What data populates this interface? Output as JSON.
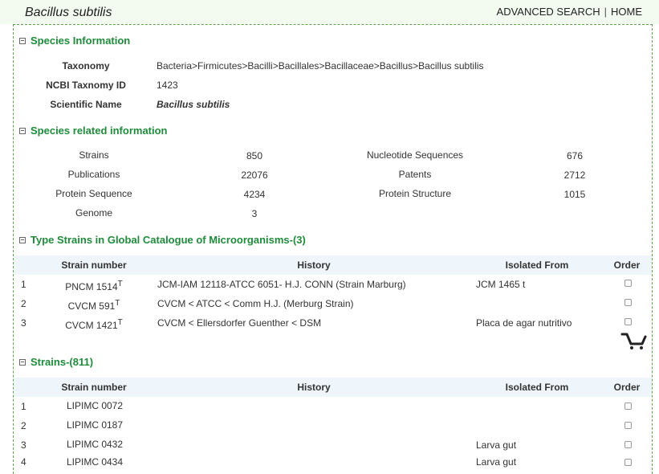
{
  "header": {
    "title": "Bacillus subtilis",
    "nav": {
      "advanced_search": "ADVANCED SEARCH",
      "separator": "|",
      "home": "HOME"
    }
  },
  "species_info": {
    "heading": "Species Information",
    "taxonomy_label": "Taxonomy",
    "taxonomy_value": "Bacteria>Firmicutes>Bacilli>Bacillales>Bacillaceae>Bacillus>Bacillus subtilis",
    "ncbi_label": "NCBI Taxnomy ID",
    "ncbi_value": "1423",
    "sci_label": "Scientific Name",
    "sci_value": "Bacillus subtilis"
  },
  "related": {
    "heading": "Species related information",
    "left": [
      {
        "label": "Strains",
        "value": "850"
      },
      {
        "label": "Publications",
        "value": "22076"
      },
      {
        "label": "Protein Sequence",
        "value": "4234"
      },
      {
        "label": "Genome",
        "value": "3"
      }
    ],
    "right": [
      {
        "label": "Nucleotide Sequences",
        "value": "676"
      },
      {
        "label": "Patents",
        "value": "2712"
      },
      {
        "label": "Protein Structure",
        "value": "1015"
      }
    ]
  },
  "type_strains": {
    "heading": "Type Strains in Global Catalogue of Microorganisms-(3)",
    "columns": [
      "Strain number",
      "History",
      "Isolated From",
      "Order"
    ],
    "rows": [
      {
        "idx": "1",
        "strain": "PNCM 1514",
        "sup": "T",
        "history": "JCM-IAM 12118-ATCC 6051- H.J. CONN (Strain Marburg)",
        "isolated": "JCM 1465 t"
      },
      {
        "idx": "2",
        "strain": "CVCM 591",
        "sup": "T",
        "history": "CVCM < ATCC < Comm H.J. (Merburg Strain)",
        "isolated": ""
      },
      {
        "idx": "3",
        "strain": "CVCM 1421",
        "sup": "T",
        "history": "CVCM < Ellersdorfer Guenther < DSM",
        "isolated": "Placa de agar nutritivo"
      }
    ]
  },
  "strains": {
    "heading": "Strains-(811)",
    "columns": [
      "Strain number",
      "History",
      "Isolated From",
      "Order"
    ],
    "rows": [
      {
        "idx": "1",
        "strain": "LIPIMC 0072",
        "history": "",
        "isolated": ""
      },
      {
        "idx": "2",
        "strain": "LIPIMC 0187",
        "history": "",
        "isolated": ""
      },
      {
        "idx": "3",
        "strain": "LIPIMC 0432",
        "history": "",
        "isolated": "Larva gut"
      },
      {
        "idx": "4",
        "strain": "LIPIMC 0434",
        "history": "",
        "isolated": "Larva gut"
      }
    ]
  },
  "icons": {
    "cart": "shopping-cart-icon",
    "collapse": "collapse-square-icon"
  },
  "colors": {
    "heading": "#1f8b3b",
    "border": "#5aa14a",
    "table_header_bg": "#eef6fb"
  }
}
